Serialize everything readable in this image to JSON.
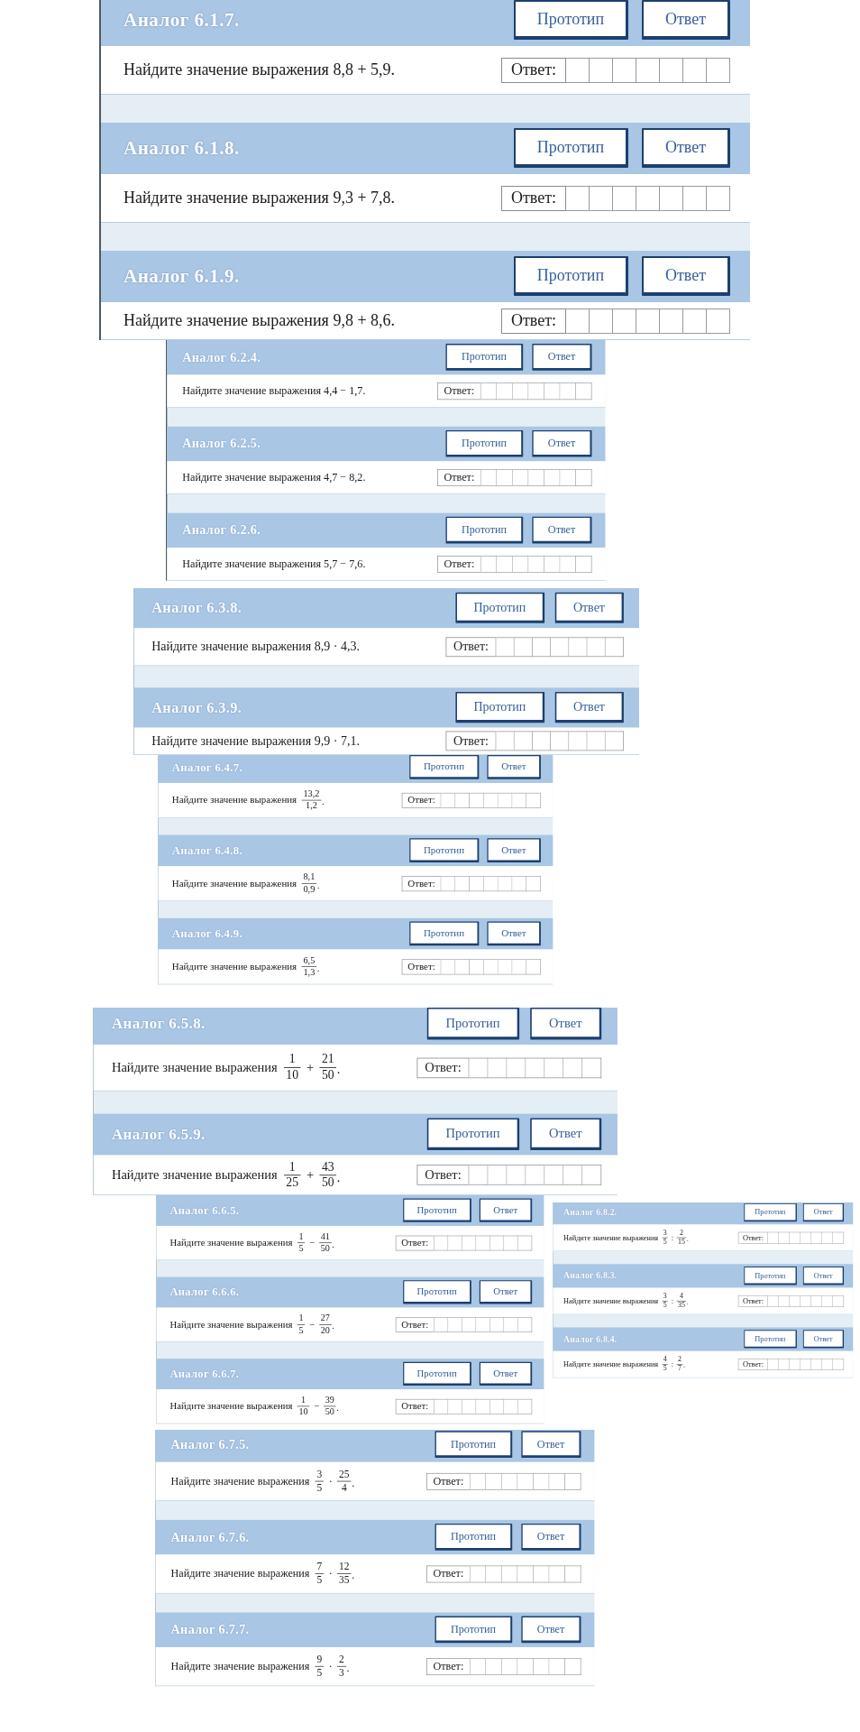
{
  "fragments": [
    {
      "cards": [
        {
          "title": "Аналог 6.1.7.",
          "buttons": [
            "Прототип",
            "Ответ"
          ],
          "task": {
            "kind": "plain",
            "text": "Найдите значение выражения 8,8 + 5,9."
          },
          "answer_label": "Ответ:"
        },
        {
          "title": "Аналог 6.1.8.",
          "buttons": [
            "Прототип",
            "Ответ"
          ],
          "task": {
            "kind": "plain",
            "text": "Найдите значение выражения 9,3 + 7,8."
          },
          "answer_label": "Ответ:"
        },
        {
          "title": "Аналог 6.1.9.",
          "buttons": [
            "Прототип",
            "Ответ"
          ],
          "task": {
            "kind": "plain",
            "text": "Найдите значение выражения 9,8 + 8,6."
          },
          "answer_label": "Ответ:"
        }
      ]
    },
    {
      "cards": [
        {
          "title": "Аналог 6.2.4.",
          "buttons": [
            "Прототип",
            "Ответ"
          ],
          "task": {
            "kind": "plain",
            "text": "Найдите значение выражения 4,4 − 1,7."
          },
          "answer_label": "Ответ:"
        },
        {
          "title": "Аналог 6.2.5.",
          "buttons": [
            "Прототип",
            "Ответ"
          ],
          "task": {
            "kind": "plain",
            "text": "Найдите значение выражения 4,7 − 8,2."
          },
          "answer_label": "Ответ:"
        },
        {
          "title": "Аналог 6.2.6.",
          "buttons": [
            "Прототип",
            "Ответ"
          ],
          "task": {
            "kind": "plain",
            "text": "Найдите значение выражения 5,7 − 7,6."
          },
          "answer_label": "Ответ:"
        }
      ]
    },
    {
      "cards": [
        {
          "title": "Аналог 6.3.8.",
          "buttons": [
            "Прототип",
            "Ответ"
          ],
          "task": {
            "kind": "plain",
            "text": "Найдите значение выражения 8,9 · 4,3."
          },
          "answer_label": "Ответ:"
        },
        {
          "title": "Аналог 6.3.9.",
          "buttons": [
            "Прототип",
            "Ответ"
          ],
          "task": {
            "kind": "plain",
            "text": "Найдите значение выражения 9,9 · 7,1."
          },
          "answer_label": "Ответ:"
        }
      ]
    },
    {
      "cards": [
        {
          "title": "Аналог 6.4.7.",
          "buttons": [
            "Прототип",
            "Ответ"
          ],
          "task": {
            "kind": "math",
            "prompt": "Найдите значение выражения",
            "expression": [
              {
                "kind": "fraction",
                "numerator": "13,2",
                "denominator": "1,2"
              },
              {
                "kind": "punctuation",
                "text": "."
              }
            ]
          },
          "answer_label": "Ответ:"
        },
        {
          "title": "Аналог 6.4.8.",
          "buttons": [
            "Прототип",
            "Ответ"
          ],
          "task": {
            "kind": "math",
            "prompt": "Найдите значение выражения",
            "expression": [
              {
                "kind": "fraction",
                "numerator": "8,1",
                "denominator": "0,9"
              },
              {
                "kind": "punctuation",
                "text": "."
              }
            ]
          },
          "answer_label": "Ответ:"
        },
        {
          "title": "Аналог 6.4.9.",
          "buttons": [
            "Прототип",
            "Ответ"
          ],
          "task": {
            "kind": "math",
            "prompt": "Найдите значение выражения",
            "expression": [
              {
                "kind": "fraction",
                "numerator": "6,5",
                "denominator": "1,3"
              },
              {
                "kind": "punctuation",
                "text": "."
              }
            ]
          },
          "answer_label": "Ответ:"
        }
      ]
    },
    {
      "cards": [
        {
          "title": "Аналог 6.5.8.",
          "buttons": [
            "Прототип",
            "Ответ"
          ],
          "task": {
            "kind": "math",
            "prompt": "Найдите значение выражения",
            "expression": [
              {
                "kind": "fraction",
                "numerator": "1",
                "denominator": "10"
              },
              {
                "kind": "operator",
                "text": "+"
              },
              {
                "kind": "fraction",
                "numerator": "21",
                "denominator": "50"
              },
              {
                "kind": "punctuation",
                "text": "."
              }
            ]
          },
          "answer_label": "Ответ:"
        },
        {
          "title": "Аналог 6.5.9.",
          "buttons": [
            "Прототип",
            "Ответ"
          ],
          "task": {
            "kind": "math",
            "prompt": "Найдите значение выражения",
            "expression": [
              {
                "kind": "fraction",
                "numerator": "1",
                "denominator": "25"
              },
              {
                "kind": "operator",
                "text": "+"
              },
              {
                "kind": "fraction",
                "numerator": "43",
                "denominator": "50"
              },
              {
                "kind": "punctuation",
                "text": "."
              }
            ]
          },
          "answer_label": "Ответ:"
        }
      ]
    },
    {
      "cards": [
        {
          "title": "Аналог 6.6.5.",
          "buttons": [
            "Прототип",
            "Ответ"
          ],
          "task": {
            "kind": "math",
            "prompt": "Найдите значение выражения",
            "expression": [
              {
                "kind": "fraction",
                "numerator": "1",
                "denominator": "5"
              },
              {
                "kind": "operator",
                "text": "−"
              },
              {
                "kind": "fraction",
                "numerator": "41",
                "denominator": "50"
              },
              {
                "kind": "punctuation",
                "text": "."
              }
            ]
          },
          "answer_label": "Ответ:"
        },
        {
          "title": "Аналог 6.6.6.",
          "buttons": [
            "Прототип",
            "Ответ"
          ],
          "task": {
            "kind": "math",
            "prompt": "Найдите значение выражения",
            "expression": [
              {
                "kind": "fraction",
                "numerator": "1",
                "denominator": "5"
              },
              {
                "kind": "operator",
                "text": "−"
              },
              {
                "kind": "fraction",
                "numerator": "27",
                "denominator": "20"
              },
              {
                "kind": "punctuation",
                "text": "."
              }
            ]
          },
          "answer_label": "Ответ:"
        },
        {
          "title": "Аналог 6.6.7.",
          "buttons": [
            "Прототип",
            "Ответ"
          ],
          "task": {
            "kind": "math",
            "prompt": "Найдите значение выражения",
            "expression": [
              {
                "kind": "fraction",
                "numerator": "1",
                "denominator": "10"
              },
              {
                "kind": "operator",
                "text": "−"
              },
              {
                "kind": "fraction",
                "numerator": "39",
                "denominator": "50"
              },
              {
                "kind": "punctuation",
                "text": "."
              }
            ]
          },
          "answer_label": "Ответ:"
        }
      ]
    },
    {
      "cards": [
        {
          "title": "Аналог 6.8.2.",
          "buttons": [
            "Прототип",
            "Ответ"
          ],
          "task": {
            "kind": "math",
            "prompt": "Найдите значение выражения",
            "expression": [
              {
                "kind": "fraction",
                "numerator": "3",
                "denominator": "5"
              },
              {
                "kind": "operator",
                "text": ":"
              },
              {
                "kind": "fraction",
                "numerator": "2",
                "denominator": "15"
              },
              {
                "kind": "punctuation",
                "text": "."
              }
            ]
          },
          "answer_label": "Ответ:"
        },
        {
          "title": "Аналог 6.8.3.",
          "buttons": [
            "Прототип",
            "Ответ"
          ],
          "task": {
            "kind": "math",
            "prompt": "Найдите значение выражения",
            "expression": [
              {
                "kind": "fraction",
                "numerator": "3",
                "denominator": "5"
              },
              {
                "kind": "operator",
                "text": ":"
              },
              {
                "kind": "fraction",
                "numerator": "4",
                "denominator": "35"
              },
              {
                "kind": "punctuation",
                "text": "."
              }
            ]
          },
          "answer_label": "Ответ:"
        },
        {
          "title": "Аналог 6.8.4.",
          "buttons": [
            "Прототип",
            "Ответ"
          ],
          "task": {
            "kind": "math",
            "prompt": "Найдите значение выражения",
            "expression": [
              {
                "kind": "fraction",
                "numerator": "4",
                "denominator": "5"
              },
              {
                "kind": "operator",
                "text": ":"
              },
              {
                "kind": "fraction",
                "numerator": "2",
                "denominator": "7"
              },
              {
                "kind": "punctuation",
                "text": "."
              }
            ]
          },
          "answer_label": "Ответ:"
        }
      ]
    },
    {
      "cards": [
        {
          "title": "Аналог 6.7.5.",
          "buttons": [
            "Прототип",
            "Ответ"
          ],
          "task": {
            "kind": "math",
            "prompt": "Найдите значение выражения",
            "expression": [
              {
                "kind": "fraction",
                "numerator": "3",
                "denominator": "5"
              },
              {
                "kind": "operator",
                "text": "·"
              },
              {
                "kind": "fraction",
                "numerator": "25",
                "denominator": "4"
              },
              {
                "kind": "punctuation",
                "text": "."
              }
            ]
          },
          "answer_label": "Ответ:"
        },
        {
          "title": "Аналог 6.7.6.",
          "buttons": [
            "Прототип",
            "Ответ"
          ],
          "task": {
            "kind": "math",
            "prompt": "Найдите значение выражения",
            "expression": [
              {
                "kind": "fraction",
                "numerator": "7",
                "denominator": "5"
              },
              {
                "kind": "operator",
                "text": "·"
              },
              {
                "kind": "fraction",
                "numerator": "12",
                "denominator": "35"
              },
              {
                "kind": "punctuation",
                "text": "."
              }
            ]
          },
          "answer_label": "Ответ:"
        },
        {
          "title": "Аналог 6.7.7.",
          "buttons": [
            "Прототип",
            "Ответ"
          ],
          "task": {
            "kind": "math",
            "prompt": "Найдите значение выражения",
            "expression": [
              {
                "kind": "fraction",
                "numerator": "9",
                "denominator": "5"
              },
              {
                "kind": "operator",
                "text": "·"
              },
              {
                "kind": "fraction",
                "numerator": "2",
                "denominator": "3"
              },
              {
                "kind": "punctuation",
                "text": "."
              }
            ]
          },
          "answer_label": "Ответ:"
        }
      ]
    }
  ]
}
